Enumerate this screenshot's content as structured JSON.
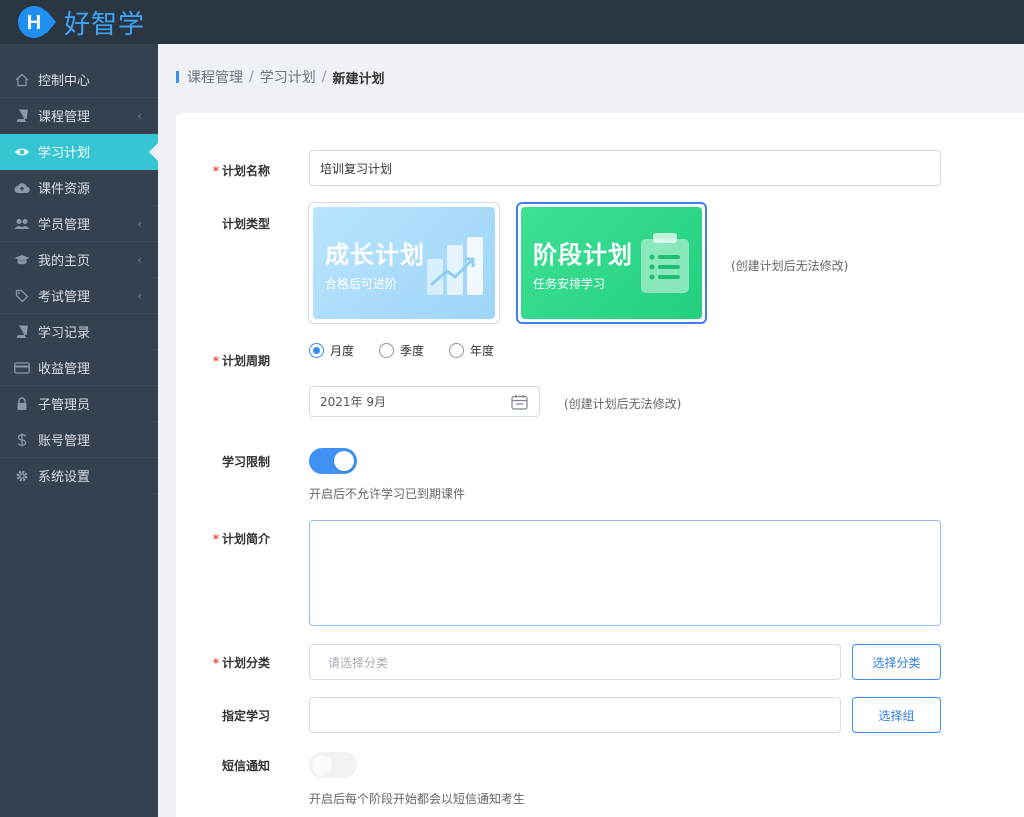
{
  "app": {
    "logo_letter": "H",
    "name": "好智学"
  },
  "sidebar": {
    "items": [
      {
        "label": "控制中心",
        "icon": "home-icon",
        "chevron": false
      },
      {
        "label": "课程管理",
        "icon": "book-icon",
        "chevron": true
      },
      {
        "label": "学习计划",
        "icon": "eye-icon",
        "chevron": false,
        "active": true
      },
      {
        "label": "课件资源",
        "icon": "cloud-upload-icon",
        "chevron": false
      },
      {
        "label": "学员管理",
        "icon": "users-icon",
        "chevron": true
      },
      {
        "label": "我的主页",
        "icon": "graduation-cap-icon",
        "chevron": true
      },
      {
        "label": "考试管理",
        "icon": "tag-icon",
        "chevron": true
      },
      {
        "label": "学习记录",
        "icon": "book-icon",
        "chevron": false
      },
      {
        "label": "收益管理",
        "icon": "credit-card-icon",
        "chevron": false
      },
      {
        "label": "子管理员",
        "icon": "lock-icon",
        "chevron": false
      },
      {
        "label": "账号管理",
        "icon": "dollar-icon",
        "chevron": false
      },
      {
        "label": "系统设置",
        "icon": "gear-icon",
        "chevron": false
      }
    ],
    "chevron_glyph": "‹"
  },
  "breadcrumb": {
    "items": [
      "课程管理",
      "学习计划"
    ],
    "current": "新建计划",
    "separator": "/"
  },
  "form": {
    "name": {
      "label": "计划名称",
      "value": "培训复习计划"
    },
    "type": {
      "label": "计划类型",
      "cards": [
        {
          "title": "成长计划",
          "subtitle": "合格后可进阶",
          "selected": false
        },
        {
          "title": "阶段计划",
          "subtitle": "任务安排学习",
          "selected": true
        }
      ],
      "hint": "(创建计划后无法修改)"
    },
    "period": {
      "label": "计划周期",
      "options": [
        {
          "label": "月度",
          "checked": true
        },
        {
          "label": "季度",
          "checked": false
        },
        {
          "label": "年度",
          "checked": false
        }
      ],
      "date_value": "2021年 9月",
      "hint": "(创建计划后无法修改)"
    },
    "limit": {
      "label": "学习限制",
      "on": true,
      "hint": "开启后不允许学习已到期课件"
    },
    "intro": {
      "label": "计划简介",
      "value": ""
    },
    "category": {
      "label": "计划分类",
      "placeholder": "请选择分类",
      "button": "选择分类"
    },
    "assign": {
      "label": "指定学习",
      "value": "",
      "button": "选择组"
    },
    "sms": {
      "label": "短信通知",
      "on": false,
      "hint": "开启后每个阶段开始都会以短信通知考生"
    },
    "required_mark": "*"
  },
  "colors": {
    "topbar": "#2b3643",
    "sidebar": "#364150",
    "active_nav": "#36c6d3",
    "primary": "#3f8ef6",
    "growth_card": "#a9dcfb",
    "stage_card": "#2fd98a"
  }
}
